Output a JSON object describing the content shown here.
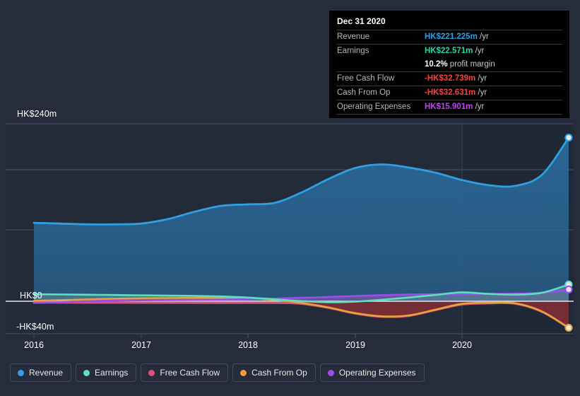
{
  "chart_data": {
    "type": "area",
    "title": "",
    "xlabel": "",
    "ylabel": "",
    "currency": "HK$",
    "unit": "m",
    "ylim": [
      -40,
      240
    ],
    "y_ticks": [
      {
        "value": 240,
        "label": "HK$240m"
      },
      {
        "value": 0,
        "label": "HK$0"
      },
      {
        "value": -40,
        "label": "-HK$40m"
      }
    ],
    "x_ticks": [
      "2016",
      "2017",
      "2018",
      "2019",
      "2020"
    ],
    "xlim": [
      "2016",
      "2021"
    ],
    "grid": true,
    "legend_position": "bottom",
    "series": [
      {
        "name": "Revenue",
        "color": "#2f9fe3",
        "fill": "#2a5375",
        "x": [
          2016.0,
          2016.25,
          2016.5,
          2016.75,
          2017.0,
          2017.25,
          2017.5,
          2017.75,
          2018.0,
          2018.25,
          2018.5,
          2018.75,
          2019.0,
          2019.25,
          2019.5,
          2019.75,
          2020.0,
          2020.25,
          2020.5,
          2020.75,
          2021.0
        ],
        "values": [
          106,
          105,
          104,
          104,
          105,
          111,
          121,
          129,
          131,
          133,
          147,
          165,
          180,
          185,
          181,
          174,
          164,
          157,
          156,
          171,
          221.225
        ]
      },
      {
        "name": "Earnings",
        "color": "#5ce0c0",
        "fill": "#3e5f77",
        "x": [
          2016.0,
          2016.25,
          2016.5,
          2016.75,
          2017.0,
          2017.25,
          2017.5,
          2017.75,
          2018.0,
          2018.25,
          2018.5,
          2018.75,
          2019.0,
          2019.25,
          2019.5,
          2019.75,
          2020.0,
          2020.25,
          2020.5,
          2020.75,
          2021.0
        ],
        "values": [
          9.5,
          9.2,
          8.8,
          8.4,
          8.0,
          7.6,
          7.2,
          6.5,
          5.0,
          2.5,
          0.2,
          -1.2,
          -0.5,
          2.0,
          5.0,
          8.5,
          12.0,
          10.0,
          9.0,
          11.5,
          22.571
        ]
      },
      {
        "name": "Free Cash Flow",
        "color": "#d8527c",
        "fill": "#6e3246",
        "x": [
          2016.0,
          2016.25,
          2016.5,
          2016.75,
          2017.0,
          2017.25,
          2017.5,
          2017.75,
          2018.0,
          2018.25,
          2018.5,
          2018.75,
          2019.0,
          2019.25,
          2019.5,
          2019.75,
          2020.0,
          2020.25,
          2020.5,
          2020.75,
          2021.0
        ],
        "values": [
          -1.5,
          -1.6,
          -1.7,
          -1.7,
          -1.8,
          -1.8,
          -1.9,
          -2.0,
          -2.0,
          -2.0,
          -3.0,
          -8.0,
          -15.0,
          -19.0,
          -18.0,
          -11.0,
          -4.0,
          -2.5,
          -3.0,
          -13.0,
          -32.739
        ]
      },
      {
        "name": "Cash From Op",
        "color": "#e9a23b",
        "fill": "#6e3246",
        "x": [
          2016.0,
          2016.25,
          2016.5,
          2016.75,
          2017.0,
          2017.25,
          2017.5,
          2017.75,
          2018.0,
          2018.25,
          2018.5,
          2018.75,
          2019.0,
          2019.25,
          2019.5,
          2019.75,
          2020.0,
          2020.25,
          2020.5,
          2020.75,
          2021.0
        ],
        "values": [
          0.5,
          1.5,
          2.5,
          3.4,
          4.0,
          4.3,
          4.5,
          4.3,
          3.8,
          2.0,
          -2.0,
          -7.5,
          -14.5,
          -18.5,
          -17.5,
          -10.5,
          -3.2,
          -1.8,
          -2.5,
          -12.5,
          -32.631
        ]
      },
      {
        "name": "Operating Expenses",
        "color": "#9b4ef0",
        "fill": "#6f4a86",
        "x": [
          2016.0,
          2016.25,
          2016.5,
          2016.75,
          2017.0,
          2017.25,
          2017.5,
          2017.75,
          2018.0,
          2018.25,
          2018.5,
          2018.75,
          2019.0,
          2019.25,
          2019.5,
          2019.75,
          2020.0,
          2020.25,
          2020.5,
          2020.75,
          2021.0
        ],
        "values": [
          -2.0,
          -1.2,
          0.0,
          0.8,
          1.2,
          1.5,
          1.8,
          2.2,
          2.8,
          3.6,
          4.6,
          5.8,
          7.0,
          8.2,
          9.0,
          9.5,
          9.8,
          10.0,
          10.2,
          11.5,
          15.901
        ]
      }
    ]
  },
  "tooltip": {
    "date": "Dec 31 2020",
    "rows": [
      {
        "key": "Revenue",
        "value": "HK$221.225m",
        "unit": "/yr",
        "color": "#2f9fe3"
      },
      {
        "key": "Earnings",
        "value": "HK$22.571m",
        "unit": "/yr",
        "color": "#27d6a8"
      },
      {
        "key": "",
        "value": "10.2%",
        "unit": "profit margin",
        "color": "#ffffff"
      },
      {
        "key": "Free Cash Flow",
        "value": "-HK$32.739m",
        "unit": "/yr",
        "color": "#f4443c"
      },
      {
        "key": "Cash From Op",
        "value": "-HK$32.631m",
        "unit": "/yr",
        "color": "#f4443c"
      },
      {
        "key": "Operating Expenses",
        "value": "HK$15.901m",
        "unit": "/yr",
        "color": "#c342f5"
      }
    ]
  },
  "legend": {
    "items": [
      {
        "label": "Revenue",
        "color": "#2f9fe3"
      },
      {
        "label": "Earnings",
        "color": "#5ce0c0"
      },
      {
        "label": "Free Cash Flow",
        "color": "#d8527c"
      },
      {
        "label": "Cash From Op",
        "color": "#e9a23b"
      },
      {
        "label": "Operating Expenses",
        "color": "#9b4ef0"
      }
    ]
  },
  "axes": {
    "y_labels": [
      "HK$240m",
      "HK$0",
      "-HK$40m"
    ],
    "x_labels": [
      "2016",
      "2017",
      "2018",
      "2019",
      "2020"
    ]
  }
}
